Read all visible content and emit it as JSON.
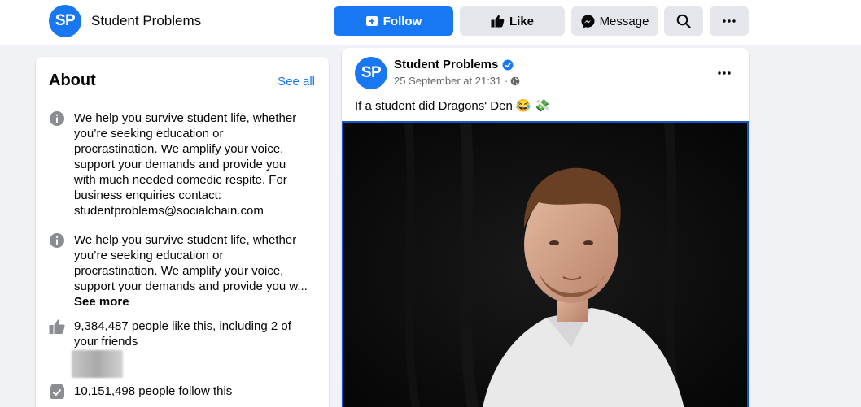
{
  "header": {
    "avatar_initials": "SP",
    "page_name": "Student Problems",
    "follow_label": "Follow",
    "like_label": "Like",
    "message_label": "Message",
    "accent_color": "#1877f2"
  },
  "about": {
    "title": "About",
    "see_all": "See all",
    "description_full": "We help you survive student life, whether you’re seeking education or procrastination. We amplify your voice, support your demands and provide you with much needed comedic respite. For business enquiries contact: studentproblems@socialchain.com",
    "description_truncated": "We help you survive student life, whether you’re seeking education or procrastination. We amplify your voice, support your demands and provide you w...",
    "see_more": "See more",
    "likes_text": "9,384,487 people like this, including 2 of your friends",
    "follows_text": "10,151,498 people follow this"
  },
  "post": {
    "avatar_initials": "SP",
    "author": "Student Problems",
    "timestamp": "25 September at 21:31 ·",
    "text": "If a student did Dragons' Den",
    "emoji_1": "😂",
    "emoji_2": "💸"
  }
}
